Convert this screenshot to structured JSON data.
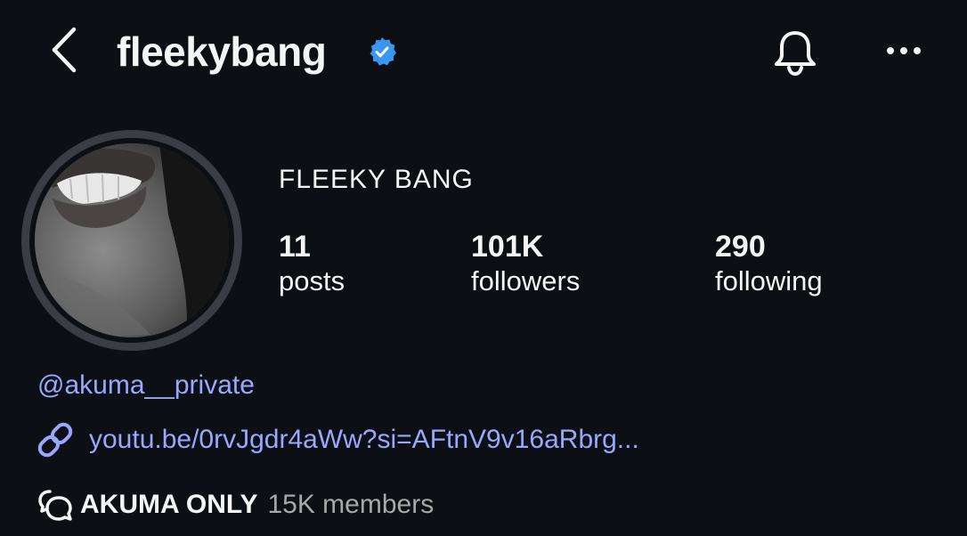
{
  "header": {
    "username": "fleekybang",
    "verified": true,
    "accent_color": "#3897f0"
  },
  "profile": {
    "display_name": "FLEEKY BANG",
    "stats": [
      {
        "value": "11",
        "label": "posts"
      },
      {
        "value": "101K",
        "label": "followers"
      },
      {
        "value": "290",
        "label": "following"
      }
    ]
  },
  "bio": {
    "mention": "@akuma__private",
    "link": "youtu.be/0rvJgdr4aWw?si=AFtnV9v16aRbrg...",
    "link_color": "#9aa7ff",
    "channel": {
      "name": "AKUMA ONLY",
      "members": "15K members"
    }
  },
  "icons": {
    "back": "chevron-left-icon",
    "verified": "verified-badge-icon",
    "notifications": "bell-icon",
    "more": "more-horizontal-icon",
    "link": "link-icon",
    "channel": "broadcast-channel-icon"
  }
}
